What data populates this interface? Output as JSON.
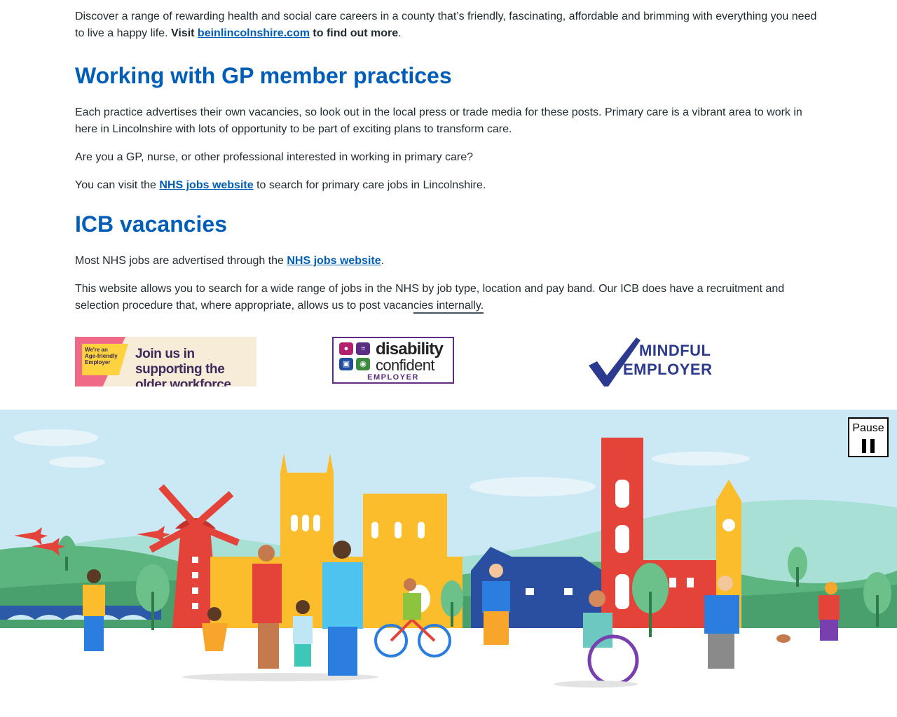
{
  "intro": {
    "text_before": "Discover a range of rewarding health and social care careers in a county that’s friendly, fascinating, affordable and brimming with everything you need to live a happy life. ",
    "visit_label": "Visit ",
    "link_text": "beinlincolnshire.com",
    "text_after_bold": " to find out more",
    "end": "."
  },
  "gp_section": {
    "heading": "Working with GP member practices",
    "para1": "Each practice advertises their own vacancies, so look out in the local press or trade media for these posts. Primary care is a vibrant area to work in here in Lincolnshire with lots of opportunity to be part of exciting plans to transform care.",
    "para2": "Are you a GP, nurse, or other professional interested in working in primary care?",
    "para3_before": "You can visit the ",
    "para3_link": "NHS jobs website",
    "para3_after": " to search for primary care jobs in Lincolnshire."
  },
  "icb_section": {
    "heading": "ICB vacancies",
    "para1_before": "Most NHS jobs are advertised through the ",
    "para1_link": "NHS jobs website",
    "para1_after": ".",
    "para2": "This website allows you to search for a wide range of jobs in the NHS by job type, location and pay band. Our ICB does have a recruitment and selection procedure that, where appropriate, allows us to post vacancies internally."
  },
  "logos": {
    "age_friendly": {
      "small_text": "We're an Age-friendly Employer",
      "main_text": "Join us in supporting the older workforce"
    },
    "disability_confident": {
      "word1": "disability",
      "word2": "confident",
      "word3": "EMPLOYER"
    },
    "mindful_employer": {
      "line1": "MINDFUL",
      "line2": "EMPLOYER"
    }
  },
  "banner": {
    "pause_label": "Pause",
    "pause_icon": "pause-icon"
  },
  "colors": {
    "link": "#005eb8",
    "heading": "#005eb8",
    "text": "#212b32",
    "sky": "#cbe9f4",
    "grass": "#5cb57e",
    "cathedral": "#fbbd2c",
    "church": "#e4433a"
  }
}
